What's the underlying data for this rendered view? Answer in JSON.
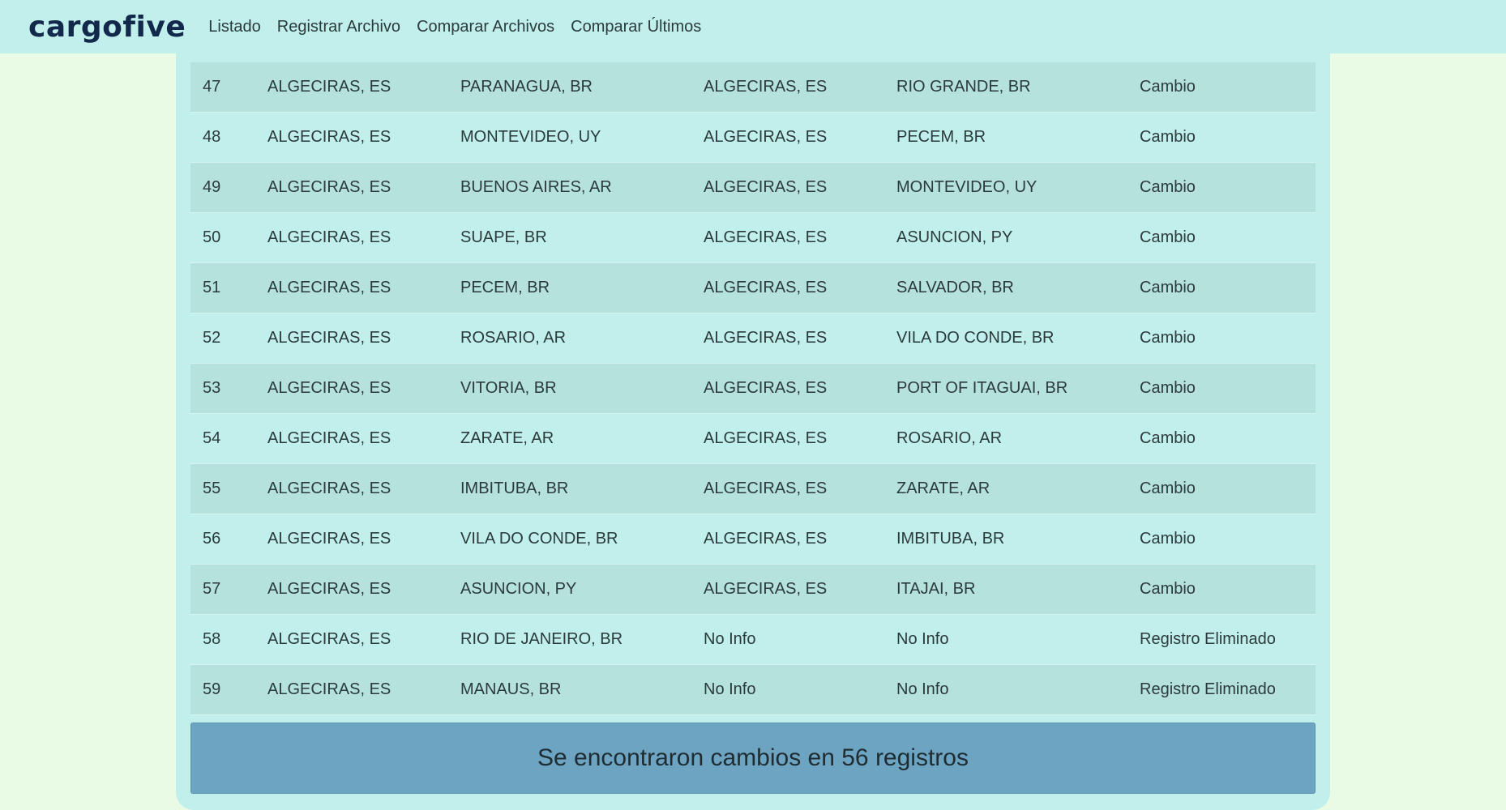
{
  "navbar": {
    "brand": "cargofive",
    "links": [
      "Listado",
      "Registrar Archivo",
      "Comparar Archivos",
      "Comparar Últimos"
    ]
  },
  "rows": [
    {
      "n": "47",
      "a": "ALGECIRAS, ES",
      "b": "PARANAGUA, BR",
      "c": "ALGECIRAS, ES",
      "d": "RIO GRANDE, BR",
      "e": "Cambio"
    },
    {
      "n": "48",
      "a": "ALGECIRAS, ES",
      "b": "MONTEVIDEO, UY",
      "c": "ALGECIRAS, ES",
      "d": "PECEM, BR",
      "e": "Cambio"
    },
    {
      "n": "49",
      "a": "ALGECIRAS, ES",
      "b": "BUENOS AIRES, AR",
      "c": "ALGECIRAS, ES",
      "d": "MONTEVIDEO, UY",
      "e": "Cambio"
    },
    {
      "n": "50",
      "a": "ALGECIRAS, ES",
      "b": "SUAPE, BR",
      "c": "ALGECIRAS, ES",
      "d": "ASUNCION, PY",
      "e": "Cambio"
    },
    {
      "n": "51",
      "a": "ALGECIRAS, ES",
      "b": "PECEM, BR",
      "c": "ALGECIRAS, ES",
      "d": "SALVADOR, BR",
      "e": "Cambio"
    },
    {
      "n": "52",
      "a": "ALGECIRAS, ES",
      "b": "ROSARIO, AR",
      "c": "ALGECIRAS, ES",
      "d": "VILA DO CONDE, BR",
      "e": "Cambio"
    },
    {
      "n": "53",
      "a": "ALGECIRAS, ES",
      "b": "VITORIA, BR",
      "c": "ALGECIRAS, ES",
      "d": "PORT OF ITAGUAI, BR",
      "e": "Cambio"
    },
    {
      "n": "54",
      "a": "ALGECIRAS, ES",
      "b": "ZARATE, AR",
      "c": "ALGECIRAS, ES",
      "d": "ROSARIO, AR",
      "e": "Cambio"
    },
    {
      "n": "55",
      "a": "ALGECIRAS, ES",
      "b": "IMBITUBA, BR",
      "c": "ALGECIRAS, ES",
      "d": "ZARATE, AR",
      "e": "Cambio"
    },
    {
      "n": "56",
      "a": "ALGECIRAS, ES",
      "b": "VILA DO CONDE, BR",
      "c": "ALGECIRAS, ES",
      "d": "IMBITUBA, BR",
      "e": "Cambio"
    },
    {
      "n": "57",
      "a": "ALGECIRAS, ES",
      "b": "ASUNCION, PY",
      "c": "ALGECIRAS, ES",
      "d": "ITAJAI, BR",
      "e": "Cambio"
    },
    {
      "n": "58",
      "a": "ALGECIRAS, ES",
      "b": "RIO DE JANEIRO, BR",
      "c": "No Info",
      "d": "No Info",
      "e": "Registro Eliminado"
    },
    {
      "n": "59",
      "a": "ALGECIRAS, ES",
      "b": "MANAUS, BR",
      "c": "No Info",
      "d": "No Info",
      "e": "Registro Eliminado"
    }
  ],
  "summary": "Se encontraron cambios en 56 registros",
  "colors": {
    "page_background": "#eafbe5",
    "navbar_background": "#c1efec",
    "row_odd": "#b6e2de",
    "row_even": "#c1efec",
    "summary_background": "#6ca4c2",
    "brand": "#13294b"
  }
}
